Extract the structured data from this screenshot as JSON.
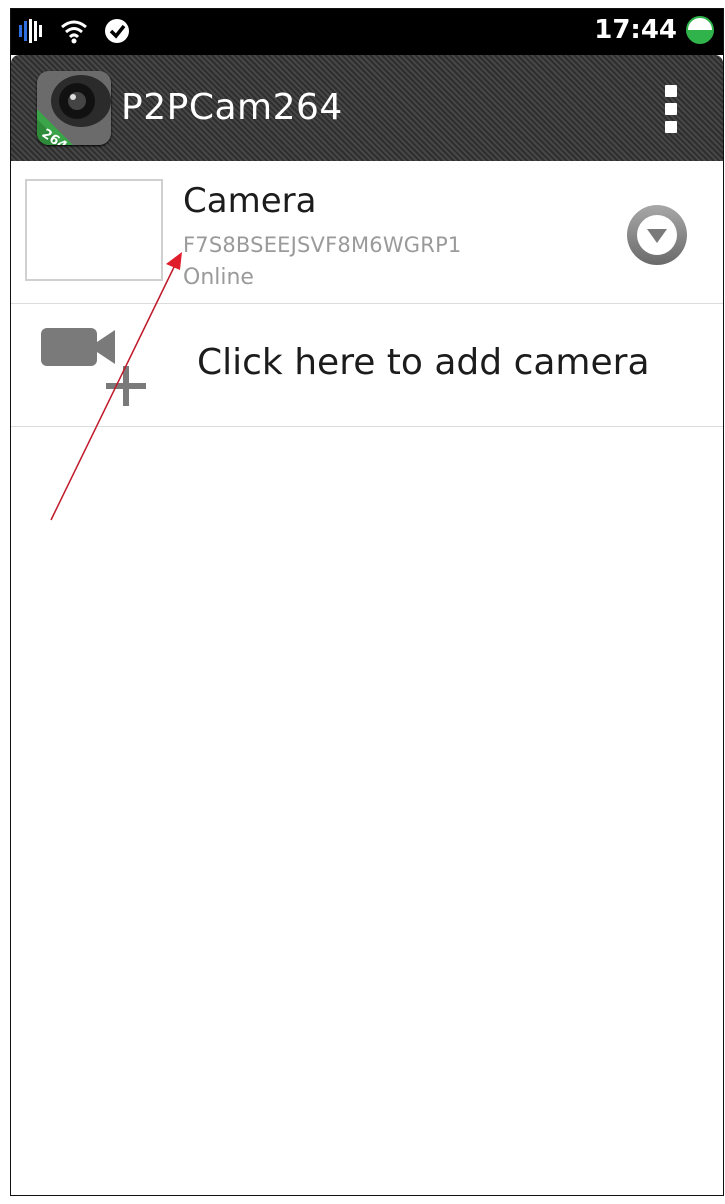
{
  "status_bar": {
    "time": "17:44",
    "icons": [
      "signal-icon",
      "wifi-icon",
      "sync-icon",
      "battery-icon"
    ],
    "battery_color": "#2fb34a"
  },
  "action_bar": {
    "title": "P2PCam264",
    "app_icon_text": "264",
    "menu_icon": "overflow-menu-icon"
  },
  "camera_list": [
    {
      "name": "Camera",
      "uid": "F7S8BSEEJSVF8M6WGRP1",
      "status": "Online",
      "action_icon": "chevron-down-circle-icon"
    }
  ],
  "add_camera": {
    "label": "Click here to add camera",
    "icon": "add-video-camera-icon"
  },
  "annotation": {
    "arrow_color": "#c0192a"
  }
}
